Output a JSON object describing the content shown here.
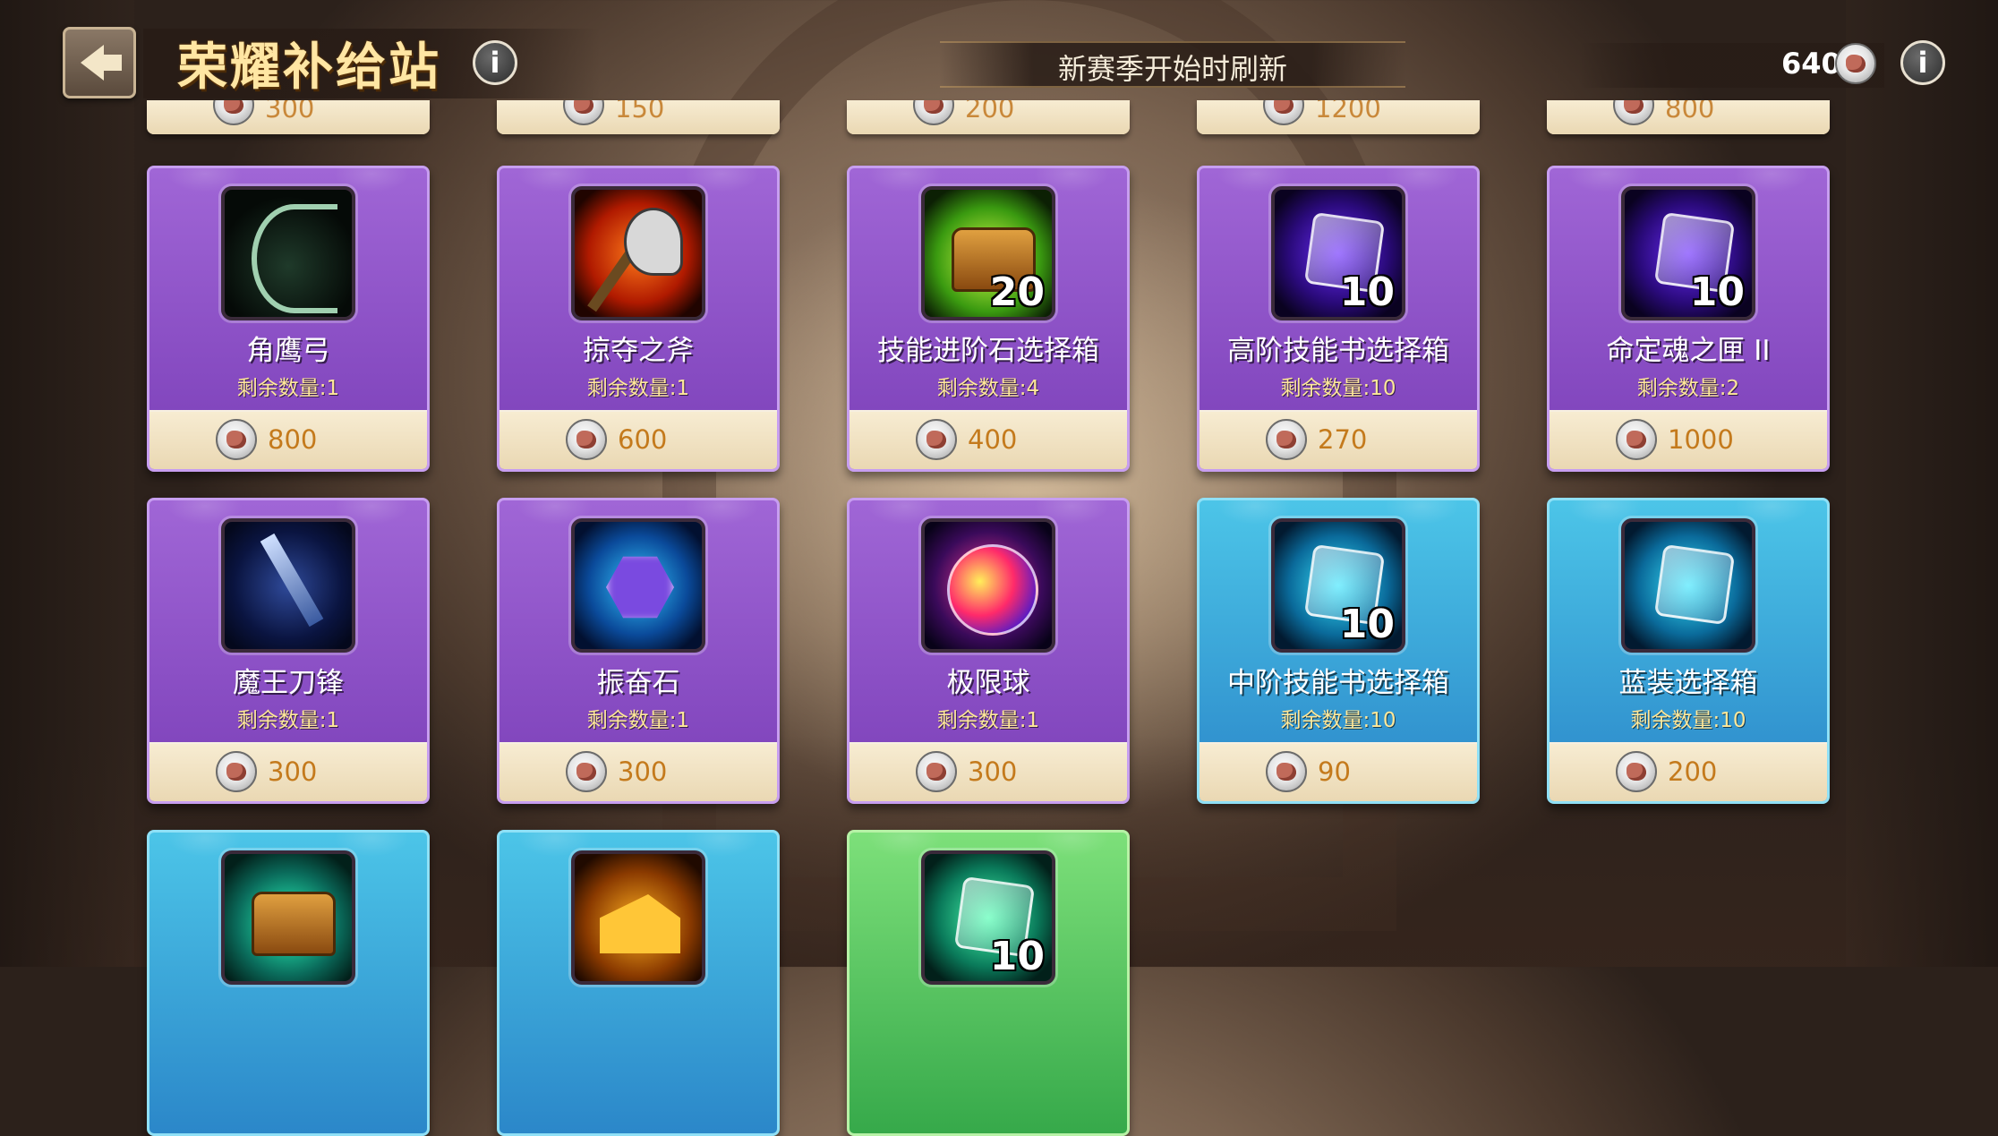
{
  "header": {
    "title": "荣耀补给站",
    "refresh_text": "新赛季开始时刷新",
    "currency_amount": "640"
  },
  "icons": {
    "back": "back-arrow-icon",
    "info": "info-icon",
    "coin": "glory-coin-icon"
  },
  "partial_row": [
    {
      "price": "300"
    },
    {
      "price": "150"
    },
    {
      "price": "200"
    },
    {
      "price": "1200"
    },
    {
      "price": "800"
    }
  ],
  "items": [
    {
      "name": "角鹰弓",
      "remain": "剩余数量:1",
      "price": "800",
      "rarity": "purple",
      "art": "bow",
      "qty": ""
    },
    {
      "name": "掠夺之斧",
      "remain": "剩余数量:1",
      "price": "600",
      "rarity": "purple",
      "art": "axe",
      "qty": ""
    },
    {
      "name": "技能进阶石选择箱",
      "remain": "剩余数量:4",
      "price": "400",
      "rarity": "purple",
      "art": "chest20",
      "qty": "20"
    },
    {
      "name": "高阶技能书选择箱",
      "remain": "剩余数量:10",
      "price": "270",
      "rarity": "purple",
      "art": "purplebox",
      "qty": "10"
    },
    {
      "name": "命定魂之匣 II",
      "remain": "剩余数量:2",
      "price": "1000",
      "rarity": "purple",
      "art": "purplebox",
      "qty": "10"
    },
    {
      "name": "魔王刀锋",
      "remain": "剩余数量:1",
      "price": "300",
      "rarity": "purple",
      "art": "sword",
      "qty": ""
    },
    {
      "name": "振奋石",
      "remain": "剩余数量:1",
      "price": "300",
      "rarity": "purple",
      "art": "gem",
      "qty": ""
    },
    {
      "name": "极限球",
      "remain": "剩余数量:1",
      "price": "300",
      "rarity": "purple",
      "art": "orb",
      "qty": ""
    },
    {
      "name": "中阶技能书选择箱",
      "remain": "剩余数量:10",
      "price": "90",
      "rarity": "blue",
      "art": "cyanbox",
      "qty": "10"
    },
    {
      "name": "蓝装选择箱",
      "remain": "剩余数量:10",
      "price": "200",
      "rarity": "blue",
      "art": "cyanbox",
      "qty": ""
    }
  ],
  "bottom_row": [
    {
      "rarity": "blue",
      "art": "greenchest",
      "qty": ""
    },
    {
      "rarity": "blue",
      "art": "cheese",
      "qty": ""
    },
    {
      "rarity": "green",
      "art": "greenbox",
      "qty": "10"
    }
  ],
  "colors": {
    "purple_card": "#8a4cc6",
    "blue_card": "#3aa6d8",
    "green_card": "#5cc860",
    "price_text": "#c47a1c",
    "remain_text": "#ffe89a",
    "title_text": "#ffe6a3"
  }
}
